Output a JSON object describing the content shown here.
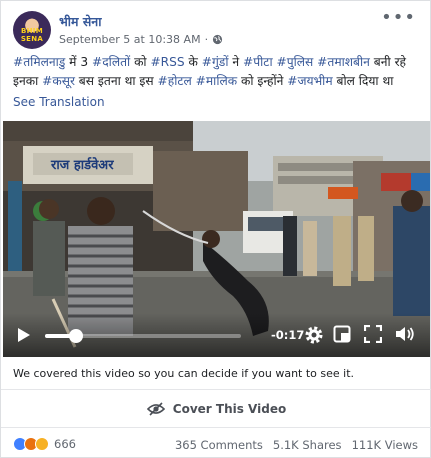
{
  "post": {
    "author": "भीम सेना",
    "timestamp": "September 5 at 10:38 AM",
    "privacy_icon": "globe-icon",
    "more_icon": "ellipsis-icon",
    "avatar_text": "BHIM SENA",
    "text_segments": [
      {
        "text": "#तमिलनाडु",
        "tag": true
      },
      {
        "text": " में 3 ",
        "tag": false
      },
      {
        "text": "#दलितों",
        "tag": true
      },
      {
        "text": " को ",
        "tag": false
      },
      {
        "text": "#RSS",
        "tag": true
      },
      {
        "text": " के ",
        "tag": false
      },
      {
        "text": "#गुंडों",
        "tag": true
      },
      {
        "text": " ने ",
        "tag": false
      },
      {
        "text": "#पीटा",
        "tag": true
      },
      {
        "text": " ",
        "tag": false
      },
      {
        "text": "#पुलिस",
        "tag": true
      },
      {
        "text": " ",
        "tag": false
      },
      {
        "text": "#तमाशबीन",
        "tag": true
      },
      {
        "text": " बनी रहे इनका ",
        "tag": false
      },
      {
        "text": "#कसूर",
        "tag": true
      },
      {
        "text": " बस इतना था इस ",
        "tag": false
      },
      {
        "text": "#होटल",
        "tag": true
      },
      {
        "text": " ",
        "tag": false
      },
      {
        "text": "#मालिक",
        "tag": true
      },
      {
        "text": " को इन्होंने ",
        "tag": false
      },
      {
        "text": "#जयभीम",
        "tag": true
      },
      {
        "text": " बोल दिया था",
        "tag": false
      }
    ],
    "see_translation": "See Translation"
  },
  "video": {
    "time_remaining": "-0:17",
    "progress": 0.16,
    "controls": [
      "play-icon",
      "settings-icon",
      "picture-in-picture-icon",
      "fullscreen-icon",
      "volume-icon"
    ],
    "shop_sign": "राज हार्डवेअर"
  },
  "cover": {
    "note": "We covered this video so you can decide if you want to see it.",
    "button_label": "Cover This Video",
    "button_icon": "eye-slash-icon"
  },
  "footer": {
    "reaction_icons": [
      "like-icon",
      "angry-icon",
      "sad-icon"
    ],
    "reaction_count": "666",
    "comments": "365 Comments",
    "shares": "5.1K Shares",
    "views": "111K Views"
  },
  "colors": {
    "link": "#385898",
    "author": "#365899",
    "muted": "#616770"
  }
}
